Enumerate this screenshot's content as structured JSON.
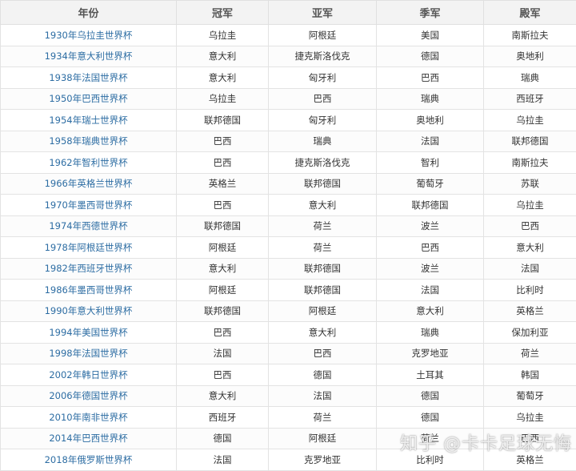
{
  "table": {
    "headers": [
      "年份",
      "冠军",
      "亚军",
      "季军",
      "殿军"
    ],
    "rows": [
      [
        "1930年乌拉圭世界杯",
        "乌拉圭",
        "阿根廷",
        "美国",
        "南斯拉夫"
      ],
      [
        "1934年意大利世界杯",
        "意大利",
        "捷克斯洛伐克",
        "德国",
        "奥地利"
      ],
      [
        "1938年法国世界杯",
        "意大利",
        "匈牙利",
        "巴西",
        "瑞典"
      ],
      [
        "1950年巴西世界杯",
        "乌拉圭",
        "巴西",
        "瑞典",
        "西班牙"
      ],
      [
        "1954年瑞士世界杯",
        "联邦德国",
        "匈牙利",
        "奥地利",
        "乌拉圭"
      ],
      [
        "1958年瑞典世界杯",
        "巴西",
        "瑞典",
        "法国",
        "联邦德国"
      ],
      [
        "1962年智利世界杯",
        "巴西",
        "捷克斯洛伐克",
        "智利",
        "南斯拉夫"
      ],
      [
        "1966年英格兰世界杯",
        "英格兰",
        "联邦德国",
        "葡萄牙",
        "苏联"
      ],
      [
        "1970年墨西哥世界杯",
        "巴西",
        "意大利",
        "联邦德国",
        "乌拉圭"
      ],
      [
        "1974年西德世界杯",
        "联邦德国",
        "荷兰",
        "波兰",
        "巴西"
      ],
      [
        "1978年阿根廷世界杯",
        "阿根廷",
        "荷兰",
        "巴西",
        "意大利"
      ],
      [
        "1982年西班牙世界杯",
        "意大利",
        "联邦德国",
        "波兰",
        "法国"
      ],
      [
        "1986年墨西哥世界杯",
        "阿根廷",
        "联邦德国",
        "法国",
        "比利时"
      ],
      [
        "1990年意大利世界杯",
        "联邦德国",
        "阿根廷",
        "意大利",
        "英格兰"
      ],
      [
        "1994年美国世界杯",
        "巴西",
        "意大利",
        "瑞典",
        "保加利亚"
      ],
      [
        "1998年法国世界杯",
        "法国",
        "巴西",
        "克罗地亚",
        "荷兰"
      ],
      [
        "2002年韩日世界杯",
        "巴西",
        "德国",
        "土耳其",
        "韩国"
      ],
      [
        "2006年德国世界杯",
        "意大利",
        "法国",
        "德国",
        "葡萄牙"
      ],
      [
        "2010年南非世界杯",
        "西班牙",
        "荷兰",
        "德国",
        "乌拉圭"
      ],
      [
        "2014年巴西世界杯",
        "德国",
        "阿根廷",
        "荷兰",
        "巴西"
      ],
      [
        "2018年俄罗斯世界杯",
        "法国",
        "克罗地亚",
        "比利时",
        "英格兰"
      ]
    ]
  },
  "watermark": {
    "text": "知乎 @卡卡足球无悔"
  },
  "colors": {
    "year_link": "#2d6da3",
    "header_bg": "#f3f3f3",
    "border": "#e3e3e3"
  }
}
